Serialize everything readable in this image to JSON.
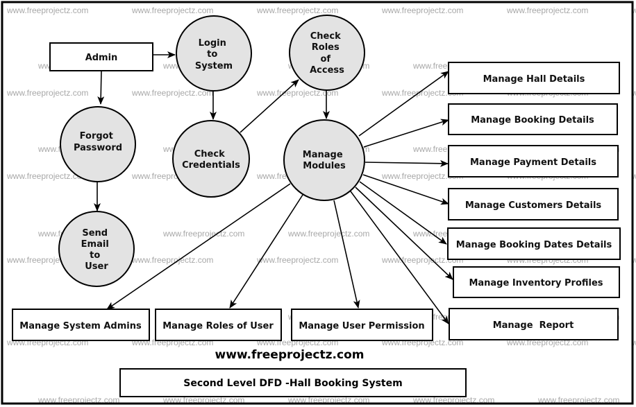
{
  "diagram": {
    "type": "data-flow-diagram",
    "level": "Second Level",
    "title": "Second Level DFD -Hall Booking System",
    "website": "www.freeprojectz.com",
    "watermark": "www.freeprojectz.com",
    "colors": {
      "process_fill": "#e3e3e3",
      "stroke": "#000000",
      "background": "#ffffff",
      "watermark": "#a8a8a8"
    }
  },
  "entities": {
    "admin": {
      "label": "Admin"
    },
    "hall": {
      "label": "Manage Hall Details"
    },
    "booking": {
      "label": "Manage Booking Details"
    },
    "payment": {
      "label": "Manage Payment Details"
    },
    "customers": {
      "label": "Manage Customers Details"
    },
    "booking_dates": {
      "label": "Manage Booking Dates Details"
    },
    "inventory": {
      "label": "Manage Inventory Profiles"
    },
    "report": {
      "label": "Manage  Report"
    },
    "system_admins": {
      "label": "Manage System Admins"
    },
    "roles_of_user": {
      "label": "Manage Roles of User"
    },
    "user_permission": {
      "label": "Manage User Permission"
    }
  },
  "processes": {
    "login": {
      "lines": [
        "Login",
        "to",
        "System"
      ]
    },
    "check_roles": {
      "lines": [
        "Check",
        "Roles",
        "of",
        "Access"
      ]
    },
    "forgot_password": {
      "lines": [
        "Forgot",
        "Password"
      ]
    },
    "check_credentials": {
      "lines": [
        "Check",
        "Credentials"
      ]
    },
    "manage_modules": {
      "lines": [
        "Manage",
        "Modules"
      ]
    },
    "send_email": {
      "lines": [
        "Send",
        "Email",
        "to",
        "User"
      ]
    }
  },
  "flows": [
    {
      "from": "admin",
      "to": "login"
    },
    {
      "from": "admin",
      "to": "forgot_password"
    },
    {
      "from": "login",
      "to": "check_credentials"
    },
    {
      "from": "check_credentials",
      "to": "check_roles"
    },
    {
      "from": "check_roles",
      "to": "manage_modules"
    },
    {
      "from": "forgot_password",
      "to": "send_email"
    },
    {
      "from": "manage_modules",
      "to": "hall"
    },
    {
      "from": "manage_modules",
      "to": "booking"
    },
    {
      "from": "manage_modules",
      "to": "payment"
    },
    {
      "from": "manage_modules",
      "to": "customers"
    },
    {
      "from": "manage_modules",
      "to": "booking_dates"
    },
    {
      "from": "manage_modules",
      "to": "inventory"
    },
    {
      "from": "manage_modules",
      "to": "report"
    },
    {
      "from": "manage_modules",
      "to": "system_admins"
    },
    {
      "from": "manage_modules",
      "to": "roles_of_user"
    },
    {
      "from": "manage_modules",
      "to": "user_permission"
    }
  ]
}
